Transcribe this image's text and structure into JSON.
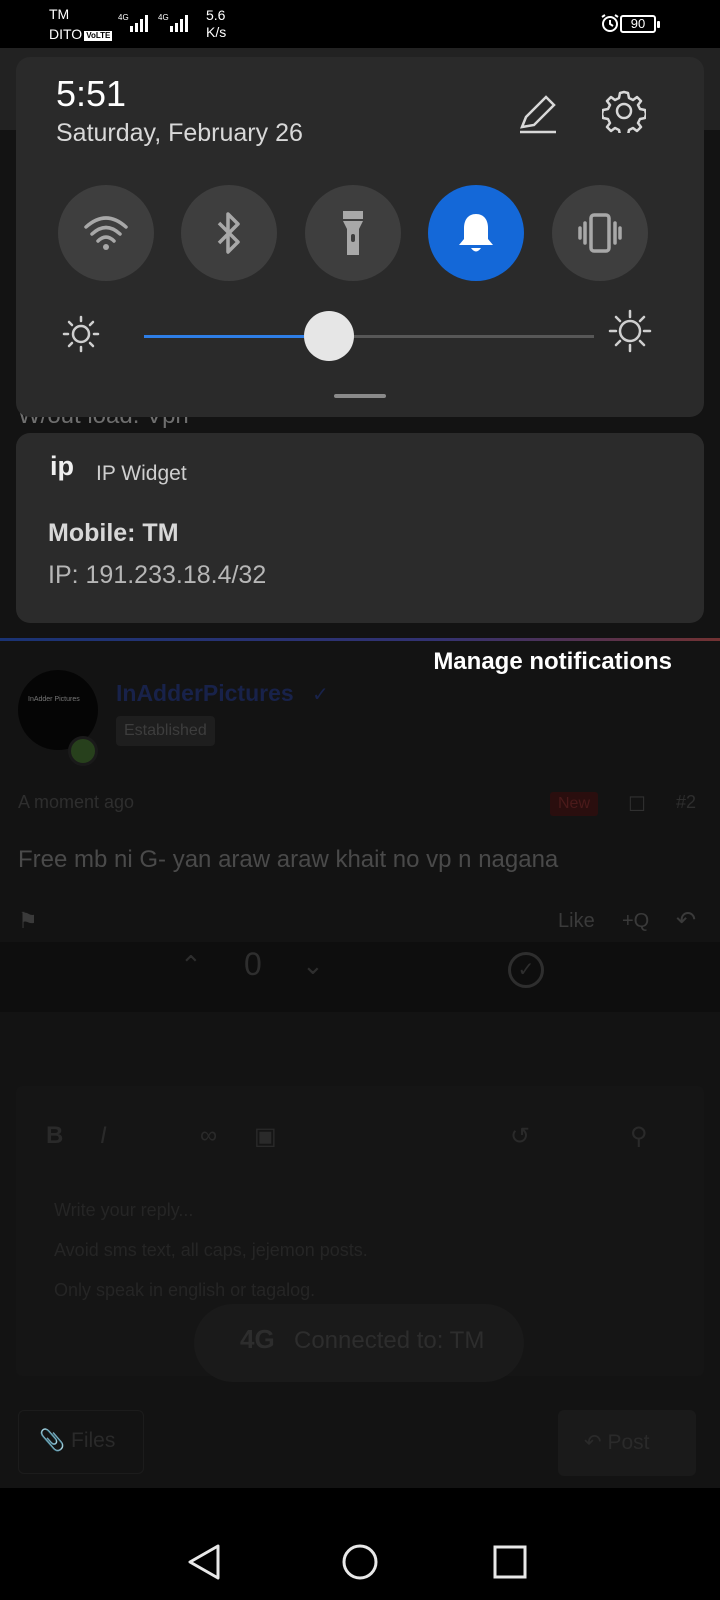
{
  "status_bar": {
    "carrier1": "TM",
    "carrier2": "DITO",
    "volte": "VoLTE",
    "net1": "4G",
    "net2": "4G",
    "speed_value": "5.6",
    "speed_unit": "K/s",
    "battery": "90",
    "alarm_icon": "alarm-clock-icon"
  },
  "quick_settings": {
    "time": "5:51",
    "date": "Saturday, February 26",
    "edit_icon": "pencil-icon",
    "settings_icon": "gear-icon",
    "tiles": [
      {
        "icon": "wifi-icon",
        "state": "off"
      },
      {
        "icon": "bluetooth-icon",
        "state": "off"
      },
      {
        "icon": "flashlight-icon",
        "state": "off"
      },
      {
        "icon": "bell-icon",
        "state": "on"
      },
      {
        "icon": "vibrate-icon",
        "state": "off"
      }
    ],
    "brightness_level": 0.41,
    "accent_color": "#1468d8"
  },
  "notification": {
    "app_icon_text": "ip",
    "app_name": "IP Widget",
    "title": "Mobile: TM",
    "text": "IP: 191.233.18.4/32"
  },
  "manage_notifications": "Manage notifications",
  "background_page": {
    "thread_title": "W/out load. Vpn",
    "avatar_text": "InAdder Pictures",
    "username": "InAdderPictures",
    "role": "Established",
    "time": "A moment ago",
    "new_badge": "New",
    "post_number": "#2",
    "post_body": "Free mb ni G- yan araw araw khait no vp n nagana",
    "like": "Like",
    "quote": "+Q",
    "score": "0",
    "reply_placeholder_1": "Write your reply...",
    "reply_placeholder_2": "Avoid sms text, all caps, jejemon posts.",
    "reply_placeholder_3": "Only speak in english or tagalog.",
    "connection_network": "4G",
    "connection_text": "Connected to: TM",
    "files_button": "Files",
    "post_button": "Post"
  },
  "nav_bar": [
    "back-icon",
    "home-icon",
    "recents-icon"
  ]
}
